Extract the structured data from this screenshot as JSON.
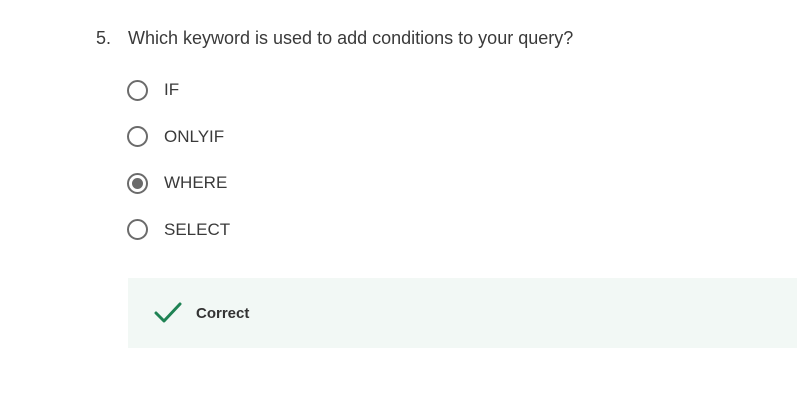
{
  "question": {
    "number": "5.",
    "text": "Which keyword is used to add conditions to your query?"
  },
  "options": [
    {
      "label": "IF",
      "selected": false
    },
    {
      "label": "ONLYIF",
      "selected": false
    },
    {
      "label": "WHERE",
      "selected": true
    },
    {
      "label": "SELECT",
      "selected": false
    }
  ],
  "feedback": {
    "status": "Correct",
    "icon": "checkmark-icon",
    "color": "#1f8354",
    "background": "#f2f8f5"
  }
}
